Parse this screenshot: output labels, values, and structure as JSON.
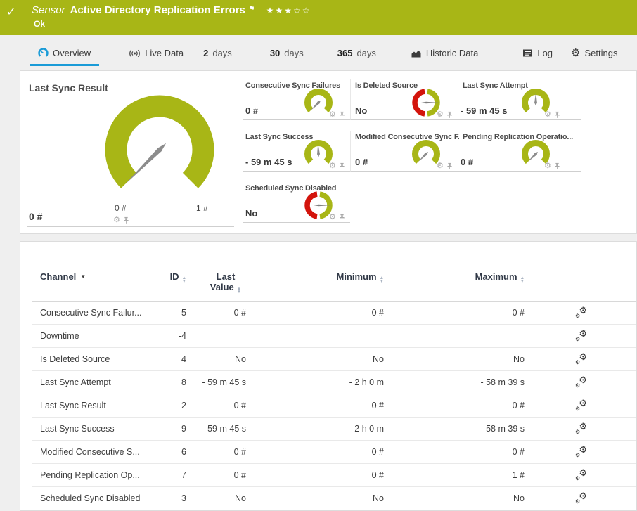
{
  "colors": {
    "ok_green": "#a8b616",
    "alarm_red": "#d3140c",
    "accent_blue": "#1a9bd7",
    "needle_gray": "#8c8c8c"
  },
  "header": {
    "check_icon": "✓",
    "kind": "Sensor",
    "title": "Active Directory Replication Errors",
    "flag_icon": "⚑",
    "rating": {
      "filled": 3,
      "total": 5
    },
    "status": "Ok"
  },
  "tabs": [
    {
      "label": "Overview",
      "icon": "gauge-icon",
      "active": true
    },
    {
      "label": "Live Data",
      "icon": "broadcast-icon"
    },
    {
      "prefix": "2",
      "label": "days"
    },
    {
      "prefix": "30",
      "label": "days"
    },
    {
      "prefix": "365",
      "label": "days"
    },
    {
      "label": "Historic Data",
      "icon": "chart-icon"
    },
    {
      "label": "Log",
      "icon": "log-icon"
    },
    {
      "label": "Settings",
      "icon": "gear-icon"
    }
  ],
  "gauges": {
    "main": {
      "title": "Last Sync Result",
      "value": "0 #",
      "scale_min": "0 #",
      "scale_max": "1 #",
      "type": "arc",
      "fraction": 0
    },
    "minis": [
      {
        "title": "Consecutive Sync Failures",
        "value": "0 #",
        "type": "arc",
        "fraction": 0
      },
      {
        "title": "Is Deleted Source",
        "value": "No",
        "type": "binary",
        "needle_deg": 90
      },
      {
        "title": "Last Sync Attempt",
        "value": "- 59 m 45 s",
        "type": "arc",
        "fraction": 0.503
      },
      {
        "title": "Last Sync Success",
        "value": "- 59 m 45 s",
        "type": "arc",
        "fraction": 0.49
      },
      {
        "title": "Modified Consecutive Sync F...",
        "value": "0 #",
        "type": "arc",
        "fraction": 0
      },
      {
        "title": "Pending Replication Operatio...",
        "value": "0 #",
        "type": "arc",
        "fraction": 0
      },
      {
        "title": "Scheduled Sync Disabled",
        "value": "No",
        "type": "binary",
        "needle_deg": 90
      }
    ]
  },
  "table": {
    "columns": [
      {
        "label": "Channel",
        "sorted": "desc"
      },
      {
        "label": "ID"
      },
      {
        "label": "Last Value"
      },
      {
        "label": "Minimum"
      },
      {
        "label": "Maximum"
      }
    ],
    "rows": [
      {
        "channel": "Consecutive Sync Failur...",
        "id": "5",
        "last": "0 #",
        "min": "0 #",
        "max": "0 #"
      },
      {
        "channel": "Downtime",
        "id": "-4",
        "last": "",
        "min": "",
        "max": ""
      },
      {
        "channel": "Is Deleted Source",
        "id": "4",
        "last": "No",
        "min": "No",
        "max": "No"
      },
      {
        "channel": "Last Sync Attempt",
        "id": "8",
        "last": "- 59 m 45 s",
        "min": "- 2 h 0 m",
        "max": "- 58 m 39 s"
      },
      {
        "channel": "Last Sync Result",
        "id": "2",
        "last": "0 #",
        "min": "0 #",
        "max": "0 #"
      },
      {
        "channel": "Last Sync Success",
        "id": "9",
        "last": "- 59 m 45 s",
        "min": "- 2 h 0 m",
        "max": "- 58 m 39 s"
      },
      {
        "channel": "Modified Consecutive S...",
        "id": "6",
        "last": "0 #",
        "min": "0 #",
        "max": "0 #"
      },
      {
        "channel": "Pending Replication Op...",
        "id": "7",
        "last": "0 #",
        "min": "0 #",
        "max": "1 #"
      },
      {
        "channel": "Scheduled Sync Disabled",
        "id": "3",
        "last": "No",
        "min": "No",
        "max": "No"
      }
    ]
  }
}
